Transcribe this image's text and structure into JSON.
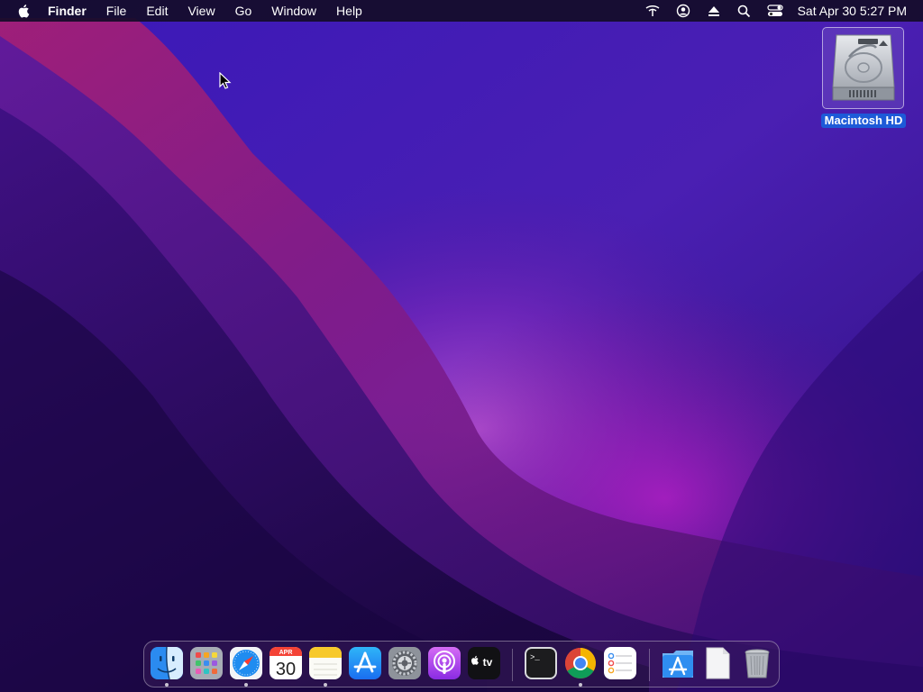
{
  "menubar": {
    "apple_icon": "apple-logo-icon",
    "app_name": "Finder",
    "items": [
      "File",
      "Edit",
      "View",
      "Go",
      "Window",
      "Help"
    ],
    "status_icons": [
      "network-icon",
      "user-account-icon",
      "eject-icon",
      "spotlight-search-icon",
      "control-center-icon"
    ],
    "clock": "Sat Apr 30  5:27 PM"
  },
  "desktop": {
    "icons": [
      {
        "label": "Macintosh HD",
        "icon": "hard-drive-icon",
        "selected": true
      }
    ]
  },
  "dock": {
    "apps": [
      {
        "name": "finder",
        "icon": "finder-icon",
        "running": true
      },
      {
        "name": "launchpad",
        "icon": "launchpad-icon",
        "running": false
      },
      {
        "name": "safari",
        "icon": "safari-icon",
        "running": true
      },
      {
        "name": "calendar",
        "icon": "calendar-icon",
        "running": false,
        "month": "APR",
        "day": "30"
      },
      {
        "name": "notes",
        "icon": "notes-icon",
        "running": true
      },
      {
        "name": "app-store",
        "icon": "app-store-icon",
        "running": false
      },
      {
        "name": "system-preferences",
        "icon": "system-preferences-icon",
        "running": false
      },
      {
        "name": "podcasts",
        "icon": "podcasts-icon",
        "running": false
      },
      {
        "name": "apple-tv",
        "icon": "apple-tv-icon",
        "running": false,
        "label": "tv"
      },
      {
        "name": "terminal",
        "icon": "terminal-icon",
        "running": false,
        "prompt": ">_"
      },
      {
        "name": "chrome",
        "icon": "chrome-icon",
        "running": true
      },
      {
        "name": "reminders",
        "icon": "reminders-icon",
        "running": false
      },
      {
        "name": "applications-folder",
        "icon": "applications-folder-icon",
        "running": false
      },
      {
        "name": "document",
        "icon": "document-icon",
        "running": false
      },
      {
        "name": "trash",
        "icon": "trash-icon",
        "running": false
      }
    ]
  },
  "colors": {
    "selection_blue": "#1d5ad8",
    "wallpaper_base": "#2a0a6e"
  }
}
